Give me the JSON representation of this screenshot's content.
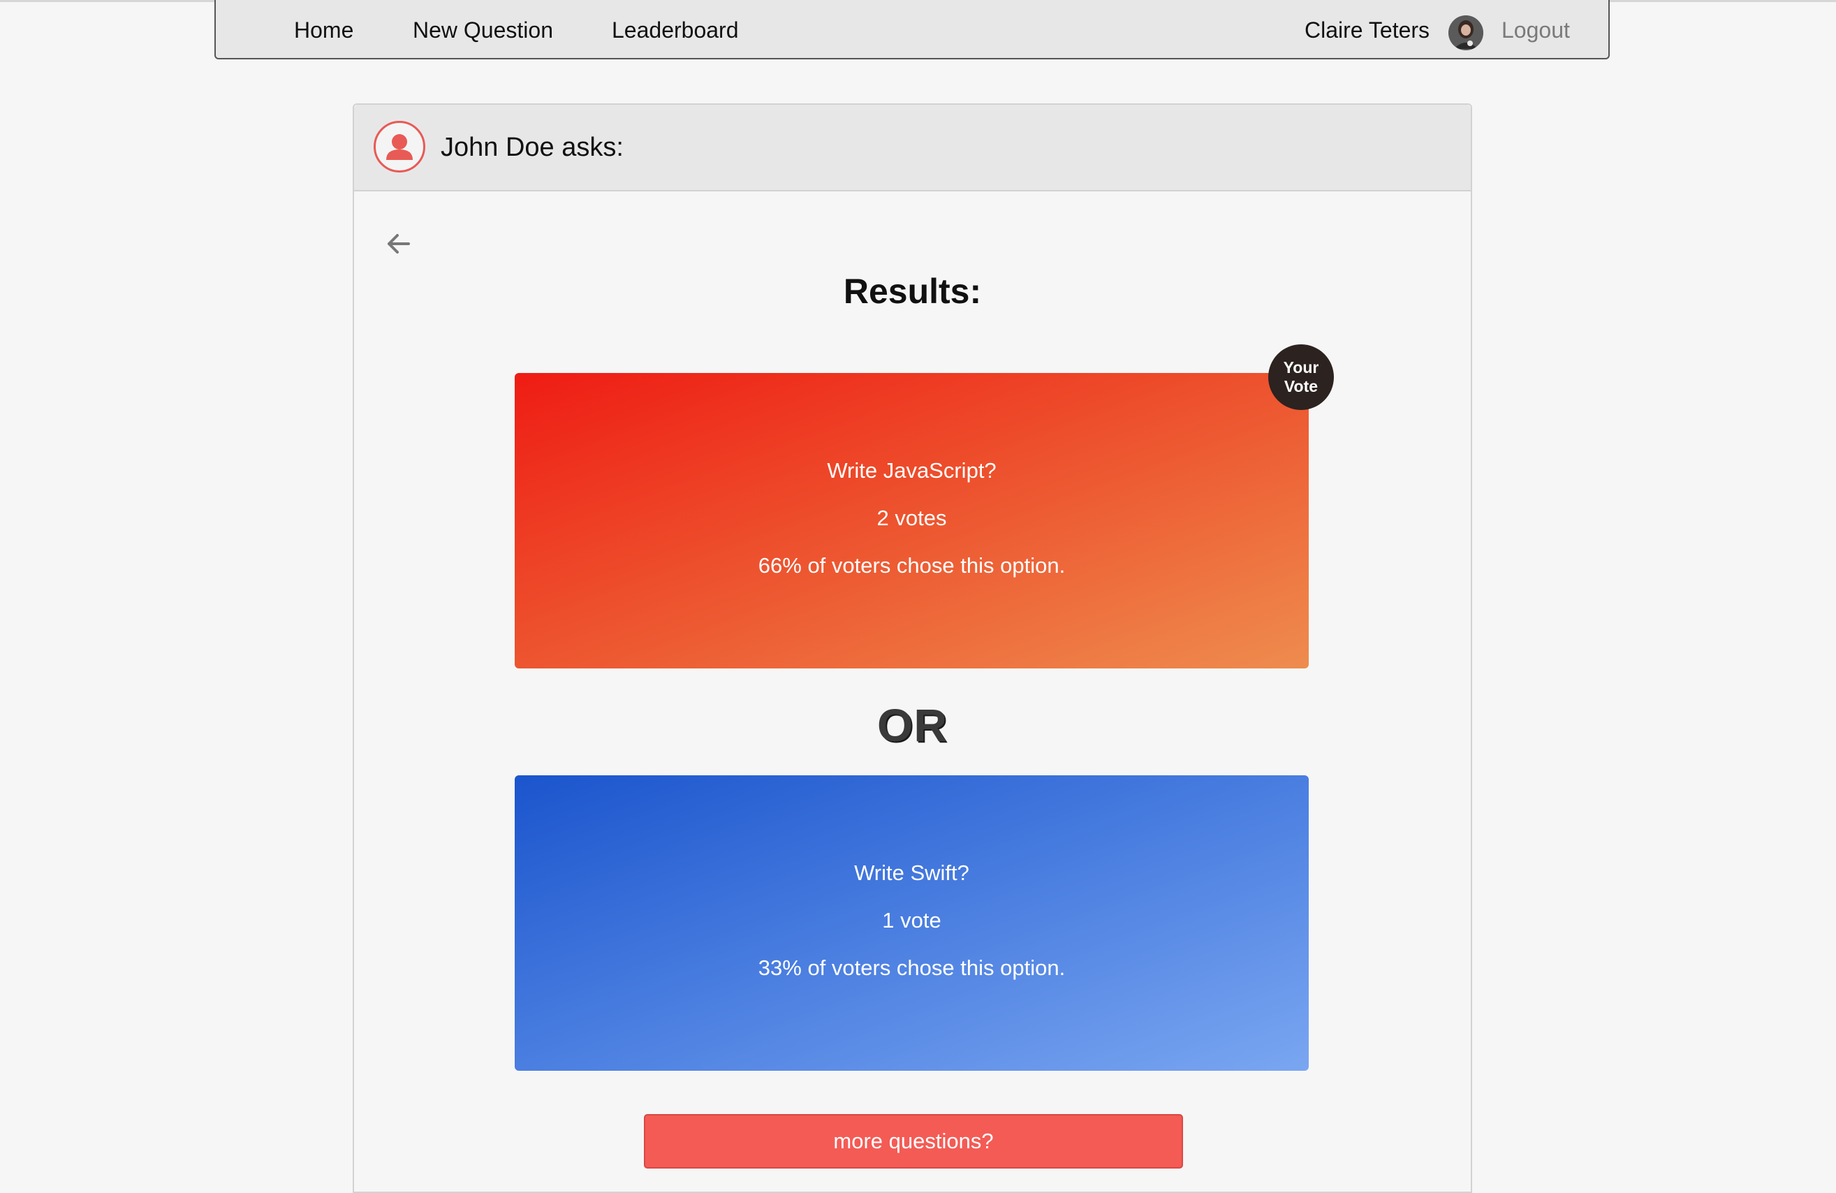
{
  "nav": {
    "home": "Home",
    "new_question": "New Question",
    "leaderboard": "Leaderboard",
    "user_name": "Claire Teters",
    "logout": "Logout"
  },
  "question": {
    "asker_text": "John Doe asks:",
    "results_title": "Results:",
    "or_label": "OR",
    "option_one": {
      "text": "Write JavaScript?",
      "votes": "2 votes",
      "percent_text": "66% of voters chose this option.",
      "color": "#ef1c14"
    },
    "option_two": {
      "text": "Write Swift?",
      "votes": "1 vote",
      "percent_text": "33% of voters chose this option.",
      "color": "#1b55cd"
    },
    "your_vote_badge": {
      "line1": "Your",
      "line2": "Vote"
    },
    "more_button": "more questions?"
  },
  "icons": {
    "back": "arrow-left-icon",
    "asker_avatar": "user-icon",
    "user_avatar": "avatar-photo"
  },
  "colors": {
    "accent": "#f45b55",
    "navbar_bg": "#e8e7e8",
    "page_bg": "#f6f6f6"
  }
}
